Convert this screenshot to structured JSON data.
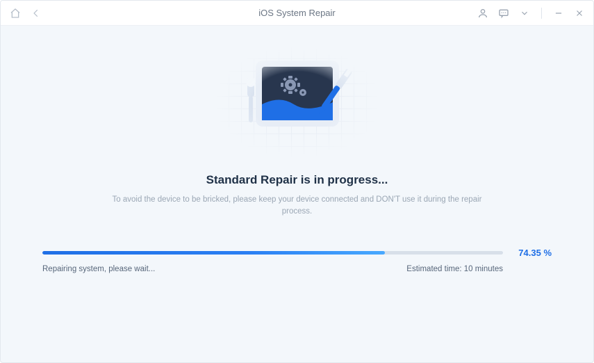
{
  "titlebar": {
    "title": "iOS System Repair"
  },
  "main": {
    "heading": "Standard Repair is in progress...",
    "subtext": "To avoid the device to be bricked, please keep your device connected and DON'T use it during the repair process."
  },
  "progress": {
    "percent_value": 74.35,
    "percent_label": "74.35 %",
    "status": "Repairing system, please wait...",
    "eta_label": "Estimated time: 10 minutes"
  },
  "colors": {
    "accent": "#1f6fe6"
  }
}
